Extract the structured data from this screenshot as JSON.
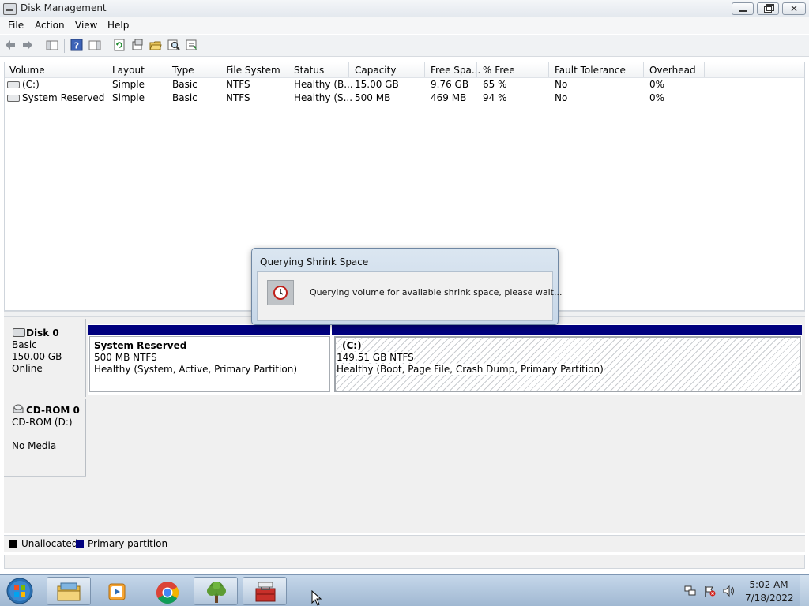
{
  "window": {
    "title": "Disk Management"
  },
  "menu": [
    "File",
    "Action",
    "View",
    "Help"
  ],
  "toolbar": {
    "buttons": [
      "back-icon",
      "forward-icon",
      "console-tree-icon",
      "help-icon",
      "show-pane-icon",
      "refresh-icon",
      "properties-icon",
      "open-icon",
      "find-icon",
      "rescan-icon"
    ]
  },
  "volume_list": {
    "columns": [
      "Volume",
      "Layout",
      "Type",
      "File System",
      "Status",
      "Capacity",
      "Free Spa...",
      "% Free",
      "Fault Tolerance",
      "Overhead"
    ],
    "rows": [
      [
        "(C:)",
        "Simple",
        "Basic",
        "NTFS",
        "Healthy (B...",
        "15.00 GB",
        "9.76 GB",
        "65 %",
        "No",
        "0%"
      ],
      [
        "System Reserved",
        "Simple",
        "Basic",
        "NTFS",
        "Healthy (S...",
        "500 MB",
        "469 MB",
        "94 %",
        "No",
        "0%"
      ]
    ]
  },
  "disks": {
    "disk0": {
      "name": "Disk 0",
      "type": "Basic",
      "size": "150.00 GB",
      "status": "Online",
      "partitions": [
        {
          "name": "System Reserved",
          "size": "500 MB NTFS",
          "status": "Healthy (System, Active, Primary Partition)"
        },
        {
          "name": "(C:)",
          "size": "149.51 GB NTFS",
          "status": "Healthy (Boot, Page File, Crash Dump, Primary Partition)"
        }
      ]
    },
    "cdrom0": {
      "name": "CD-ROM 0",
      "drive": "CD-ROM (D:)",
      "media": "No Media"
    }
  },
  "legend": [
    {
      "label": "Unallocated",
      "color": "#000000"
    },
    {
      "label": "Primary partition",
      "color": "#00007e"
    }
  ],
  "dialog": {
    "title": "Querying Shrink Space",
    "message": "Querying volume for available shrink space, please wait..."
  },
  "taskbar": {
    "apps": [
      "start-orb-icon",
      "windows-explorer-icon",
      "media-player-icon",
      "chrome-icon",
      "tree-app-icon",
      "toolbox-app-icon"
    ],
    "tray": [
      "network-icon",
      "action-center-flag-icon",
      "volume-icon"
    ],
    "time": "5:02 AM",
    "date": "7/18/2022"
  }
}
